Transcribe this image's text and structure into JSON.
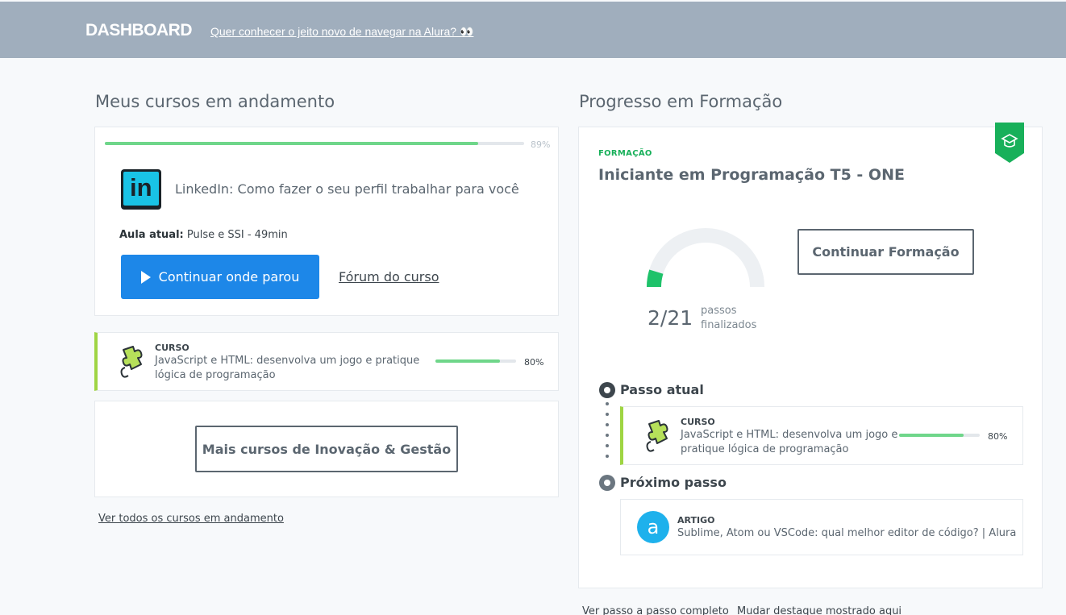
{
  "header": {
    "brand": "DASHBOARD",
    "promo_link": "Quer conhecer o jeito novo de navegar na Alura? 👀"
  },
  "courses": {
    "section_title": "Meus cursos em andamento",
    "featured": {
      "progress_percent": 89,
      "progress_label": "89%",
      "logo_text": "in",
      "title": "LinkedIn: Como fazer o seu perfil trabalhar para você",
      "current_lesson_label": "Aula atual:",
      "current_lesson_value": "Pulse e SSI - 49min",
      "continue_button": "Continuar onde parou",
      "forum_link": "Fórum do curso"
    },
    "item": {
      "kind": "CURSO",
      "title": "JavaScript e HTML: desenvolva um jogo e pratique lógica de programação",
      "progress_percent": 80,
      "progress_label": "80%",
      "icon": "puzzle-icon"
    },
    "more_button": "Mais cursos de Inovação & Gestão",
    "see_all_link": "Ver todos os cursos em andamento"
  },
  "formation": {
    "section_title": "Progresso em Formação",
    "tag": "FORMAÇÃO",
    "title": "Iniciante em Programação T5 - ONE",
    "badge_icon": "graduation-cap-icon",
    "steps_done": 2,
    "steps_total": 21,
    "steps_display": "2/21",
    "steps_label": "passos finalizados",
    "continue_button": "Continuar Formação",
    "current_step_label": "Passo atual",
    "current_step": {
      "kind": "CURSO",
      "title": "JavaScript e HTML: desenvolva um jogo e pratique lógica de programação",
      "progress_percent": 80,
      "progress_label": "80%"
    },
    "next_step_label": "Próximo passo",
    "next_step": {
      "kind": "ARTIGO",
      "title": "Sublime, Atom ou VSCode: qual melhor editor de código? | Alura",
      "avatar_text": "a"
    },
    "footer_links": [
      "Ver passo a passo completo",
      "Mudar destaque mostrado aqui"
    ]
  },
  "colors": {
    "header_bg": "#a0aebd",
    "primary": "#1d87e8",
    "progress": "#6fd68a",
    "accent_green": "#18b05a",
    "course_stripe": "#9fd543"
  }
}
